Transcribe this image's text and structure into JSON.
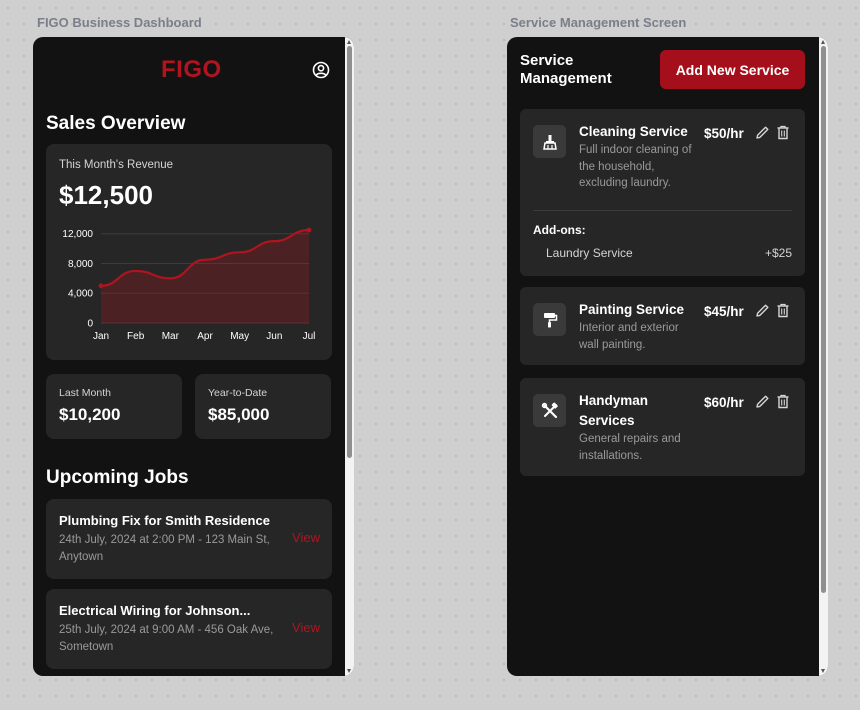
{
  "labels": {
    "dashboard_frame": "FIGO Business Dashboard",
    "service_frame": "Service Management Screen"
  },
  "dashboard": {
    "logo": "FIGO",
    "profile_icon": "user-circle-icon",
    "sales_title": "Sales Overview",
    "revenue_label": "This Month's Revenue",
    "revenue_value": "$12,500",
    "last_month_label": "Last Month",
    "last_month_value": "$10,200",
    "ytd_label": "Year-to-Date",
    "ytd_value": "$85,000",
    "jobs_title": "Upcoming Jobs",
    "jobs": [
      {
        "title": "Plumbing Fix for Smith Residence",
        "desc": "24th July, 2024 at 2:00 PM - 123 Main St, Anytown",
        "action": "View"
      },
      {
        "title": "Electrical Wiring for Johnson...",
        "desc": "25th July, 2024 at 9:00 AM - 456 Oak Ave, Sometown",
        "action": "View"
      }
    ],
    "accent_color": "#b0141f"
  },
  "chart_data": {
    "type": "area",
    "categories": [
      "Jan",
      "Feb",
      "Mar",
      "Apr",
      "May",
      "Jun",
      "Jul"
    ],
    "series": [
      {
        "values": [
          5000,
          7000,
          6000,
          8500,
          9500,
          11000,
          12500
        ]
      }
    ],
    "yticks": [
      "0",
      "4,000",
      "8,000",
      "12,000"
    ],
    "ylim": [
      0,
      12500
    ],
    "grid": true,
    "color": "#b0141f"
  },
  "services": {
    "title_line1": "Service",
    "title_line2": "Management",
    "add_button": "Add New Service",
    "items": [
      {
        "icon": "broom-icon",
        "name_lines": [
          "Cleaning Service"
        ],
        "desc_lines": [
          "Full indoor cleaning of",
          "the household,",
          "excluding laundry."
        ],
        "price": "$50/hr",
        "addons_label": "Add-ons:",
        "addons": [
          {
            "name": "Laundry Service",
            "price": "+$25"
          }
        ]
      },
      {
        "icon": "paint-roller-icon",
        "name_lines": [
          "Painting Service"
        ],
        "desc_lines": [
          "Interior and exterior",
          "wall painting."
        ],
        "price": "$45/hr"
      },
      {
        "icon": "tools-icon",
        "name_lines": [
          "Handyman",
          "Services"
        ],
        "desc_lines": [
          "General repairs and",
          "installations."
        ],
        "price": "$60/hr"
      }
    ]
  }
}
